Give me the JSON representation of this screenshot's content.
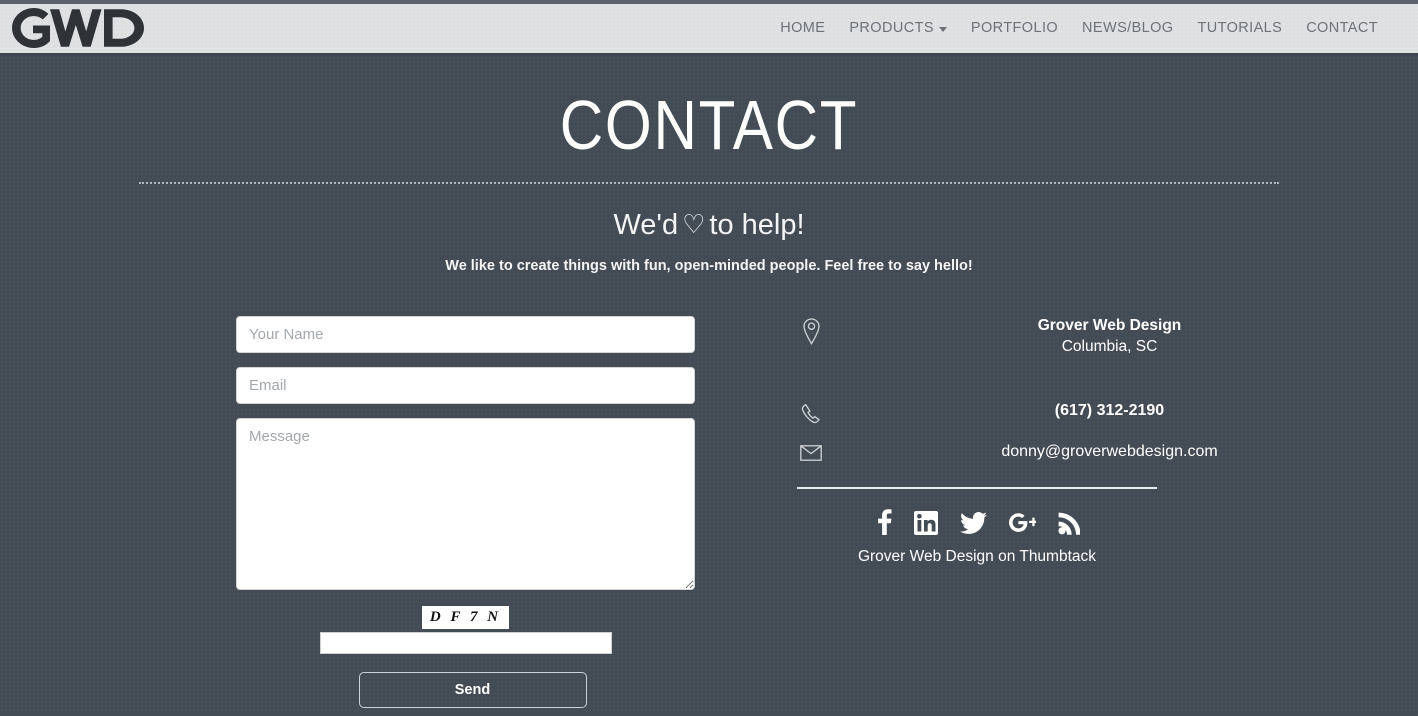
{
  "header": {
    "logo_text": "GWD",
    "nav": [
      {
        "label": "HOME",
        "has_caret": false
      },
      {
        "label": "PRODUCTS",
        "has_caret": true
      },
      {
        "label": "PORTFOLIO",
        "has_caret": false
      },
      {
        "label": "NEWS/BLOG",
        "has_caret": false
      },
      {
        "label": "TUTORIALS",
        "has_caret": false
      },
      {
        "label": "CONTACT",
        "has_caret": false
      }
    ]
  },
  "hero": {
    "title": "CONTACT",
    "lede_before": "We'd",
    "lede_heart": "♡",
    "lede_after": "to help!",
    "sub_lede": "We like to create things with fun, open-minded people. Feel free to say hello!"
  },
  "form": {
    "name_placeholder": "Your Name",
    "name_value": "",
    "email_placeholder": "Email",
    "email_value": "",
    "message_placeholder": "Message",
    "message_value": "",
    "captcha_text": "D F 7 N",
    "captcha_input_value": "",
    "send_label": "Send"
  },
  "info": {
    "org_name": "Grover Web Design",
    "org_city": "Columbia, SC",
    "phone": "(617) 312-2190",
    "email": "donny@groverwebdesign.com",
    "thumbtack_label": "Grover Web Design on Thumbtack",
    "social": [
      {
        "name": "facebook-icon"
      },
      {
        "name": "linkedin-icon"
      },
      {
        "name": "twitter-icon"
      },
      {
        "name": "googleplus-icon"
      },
      {
        "name": "rss-icon"
      }
    ]
  },
  "colors": {
    "page_background": "#434b54",
    "header_background": "#e0e1e3",
    "nav_text": "#6d7278",
    "logo": "#2f3338",
    "text_light": "#ffffff",
    "field_background": "#ffffff",
    "placeholder": "#a3a8ad"
  }
}
